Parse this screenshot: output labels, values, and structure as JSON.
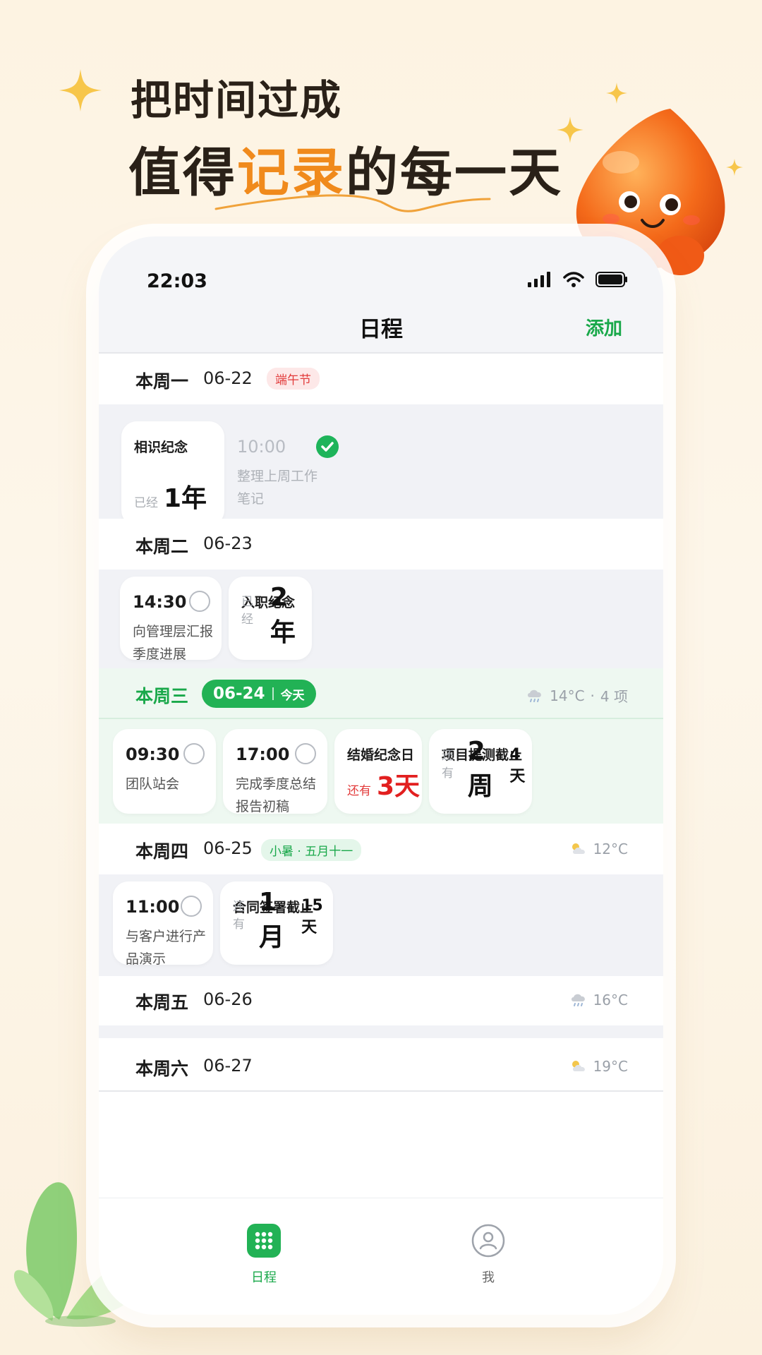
{
  "hero": {
    "line1": "把时间过成",
    "line2_pre": "值得",
    "line2_accent": "记录",
    "line2_post": "的每一天"
  },
  "status": {
    "time": "22:03"
  },
  "nav": {
    "title": "日程",
    "add": "添加"
  },
  "days": [
    {
      "label": "本周一",
      "date": "06-22",
      "tag": "端午节",
      "cards": [
        {
          "kind": "anniversary",
          "title": "相识纪念",
          "prefix": "已经",
          "big": "1年"
        },
        {
          "kind": "task",
          "time": "10:00",
          "text": "整理上周工作\n笔记",
          "done": true
        }
      ]
    },
    {
      "label": "本周二",
      "date": "06-23",
      "cards": [
        {
          "kind": "task",
          "time": "14:30",
          "text": "向管理层汇报\n季度进展",
          "done": false
        },
        {
          "kind": "anniversary",
          "title": "入职纪念",
          "prefix": "已经",
          "big": "2年"
        }
      ]
    },
    {
      "label": "本周三",
      "date": "06-24",
      "today_tag": "今天",
      "weather": "14°C",
      "count": "4 项",
      "weather_icon": "rain-cloud-icon",
      "cards": [
        {
          "kind": "task",
          "time": "09:30",
          "text": "团队站会",
          "done": false
        },
        {
          "kind": "task",
          "time": "17:00",
          "text": "完成季度总结\n报告初稿",
          "done": false
        },
        {
          "kind": "countdown",
          "title": "结婚纪念日",
          "prefix": "还有",
          "big": "3天",
          "urgent": true
        },
        {
          "kind": "countdown",
          "title": "项目提测截止",
          "prefix": "还有",
          "big": "2周",
          "small": "4天"
        }
      ]
    },
    {
      "label": "本周四",
      "date": "06-25",
      "tag": "小暑 · 五月十一",
      "weather": "12°C",
      "weather_icon": "sun-cloud-icon",
      "cards": [
        {
          "kind": "task",
          "time": "11:00",
          "text": "与客户进行产\n品演示",
          "done": false
        },
        {
          "kind": "countdown",
          "title": "合同签署截止",
          "prefix": "还有",
          "big": "1月",
          "small": "15天"
        }
      ]
    },
    {
      "label": "本周五",
      "date": "06-26",
      "weather": "16°C",
      "weather_icon": "rain-cloud-icon"
    },
    {
      "label": "本周六",
      "date": "06-27",
      "weather": "19°C",
      "weather_icon": "sun-cloud-icon"
    }
  ],
  "tabbar": {
    "schedule": "日程",
    "me": "我"
  },
  "colors": {
    "accent": "#19a84a",
    "hero_accent": "#f08a1c",
    "urgent": "#e21f1f"
  }
}
